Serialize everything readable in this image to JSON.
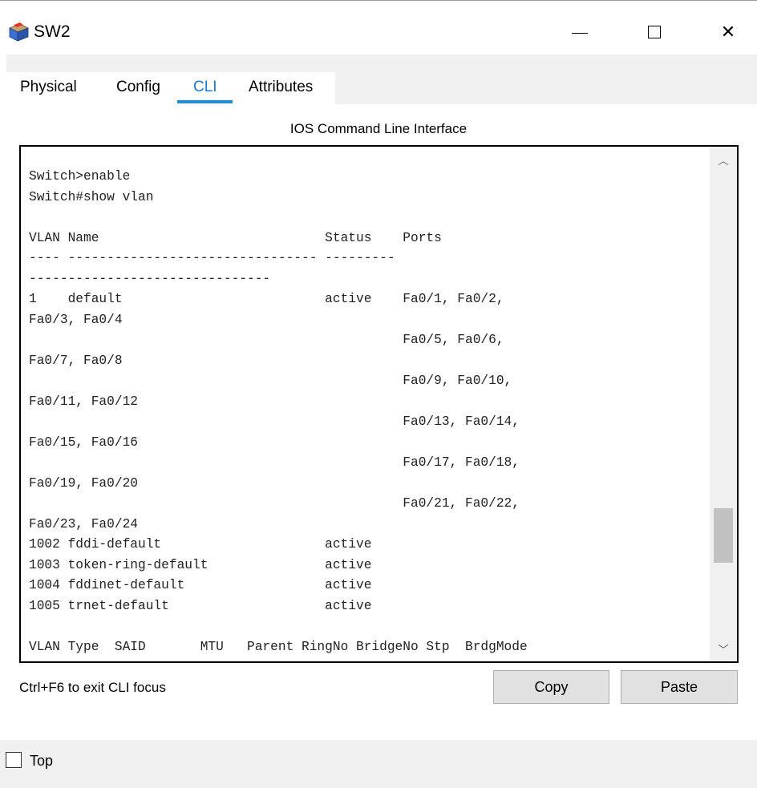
{
  "window": {
    "title": "SW2",
    "icon": "switch-device-icon"
  },
  "title_controls": {
    "minimize": "minimize-icon",
    "maximize": "maximize-icon",
    "close": "close-icon",
    "close_glyph": "✕"
  },
  "tabs": [
    {
      "label": "Physical",
      "active": false
    },
    {
      "label": "Config",
      "active": false
    },
    {
      "label": "CLI",
      "active": true
    },
    {
      "label": "Attributes",
      "active": false
    }
  ],
  "cli": {
    "section_title": "IOS Command Line Interface",
    "output": "Switch>enable\nSwitch#show vlan\n\nVLAN Name                             Status    Ports\n---- -------------------------------- ---------\n-------------------------------\n1    default                          active    Fa0/1, Fa0/2,\nFa0/3, Fa0/4\n                                                Fa0/5, Fa0/6,\nFa0/7, Fa0/8\n                                                Fa0/9, Fa0/10,\nFa0/11, Fa0/12\n                                                Fa0/13, Fa0/14,\nFa0/15, Fa0/16\n                                                Fa0/17, Fa0/18,\nFa0/19, Fa0/20\n                                                Fa0/21, Fa0/22,\nFa0/23, Fa0/24\n1002 fddi-default                     active\n1003 token-ring-default               active\n1004 fddinet-default                  active\n1005 trnet-default                    active\n\nVLAN Type  SAID       MTU   Parent RingNo BridgeNo Stp  BrdgMode",
    "scroll_up_glyph": "︿",
    "scroll_down_glyph": "﹀",
    "scroll_position": 0.82
  },
  "footer": {
    "hint": "Ctrl+F6 to exit CLI focus",
    "copy_label": "Copy",
    "paste_label": "Paste"
  },
  "bottom": {
    "top_label": "Top",
    "top_checked": false
  }
}
